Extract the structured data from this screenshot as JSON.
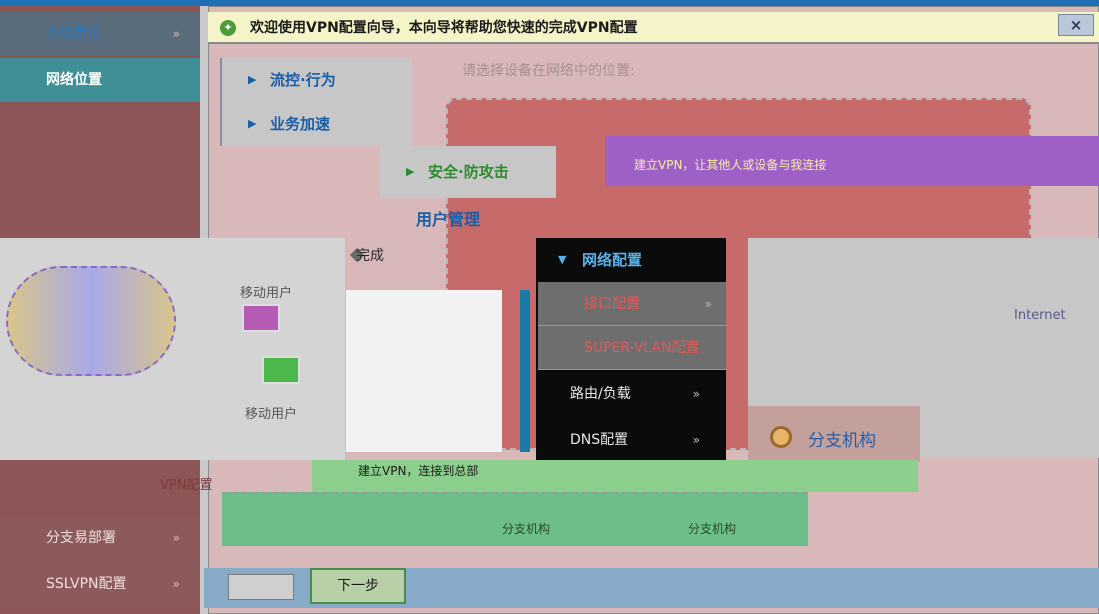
{
  "sidebar": {
    "home": "系统首页",
    "network_position": "网络位置",
    "branch_deploy": "分支易部署",
    "sslvpn_config": "SSLVPN配置",
    "chevron": "»"
  },
  "wizard": {
    "title": "欢迎使用VPN配置向导，本向导将帮助您快速的完成VPN配置",
    "close": "×",
    "hint": "请选择设备在网络中的位置:",
    "option_build_vpn_text": "建立VPN，让其他人或设备与我连接",
    "finish": "完成",
    "internet": "Internet",
    "mobile_user_1": "移动用户",
    "mobile_user_2": "移动用户",
    "hq_branch": "分支机构",
    "vpn_to_hq_text": "建立VPN，连接到总部",
    "branch_1": "分支机构",
    "branch_2": "分支机构",
    "vpn_config": "VPN配置",
    "next_button": "下一步"
  },
  "menus": {
    "flow_control": "流控·行为",
    "business_accel": "业务加速",
    "security": "安全·防攻击",
    "user_mgmt": "用户管理",
    "network_config": "网络配置",
    "interface_config": "接口配置",
    "super_vlan": "SUPER-VLAN配置",
    "route_load": "路由/负载",
    "dns_config": "DNS配置",
    "chevron": "»"
  }
}
